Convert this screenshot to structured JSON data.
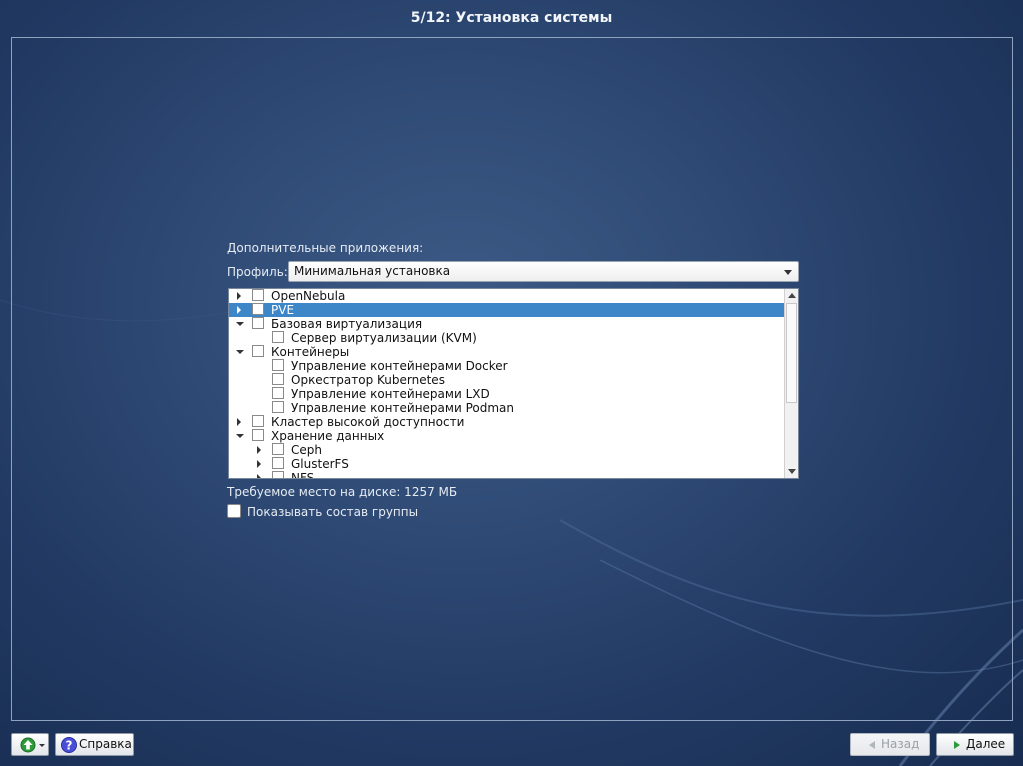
{
  "header": {
    "title": "5/12: Установка системы"
  },
  "apps": {
    "section_label": "Дополнительные приложения:",
    "profile_label": "Профиль:",
    "profile_value": "Минимальная установка",
    "tree": [
      {
        "label": "OpenNebula",
        "level": 0,
        "expander": "collapsed",
        "checked": false,
        "selected": false
      },
      {
        "label": "PVE",
        "level": 0,
        "expander": "collapsed",
        "checked": false,
        "selected": true
      },
      {
        "label": "Базовая виртуализация",
        "level": 0,
        "expander": "expanded",
        "checked": false,
        "selected": false
      },
      {
        "label": "Сервер виртуализации (KVM)",
        "level": 1,
        "expander": "none",
        "checked": false,
        "selected": false
      },
      {
        "label": "Контейнеры",
        "level": 0,
        "expander": "expanded",
        "checked": false,
        "selected": false
      },
      {
        "label": "Управление контейнерами Docker",
        "level": 1,
        "expander": "none",
        "checked": false,
        "selected": false
      },
      {
        "label": "Оркестратор Kubernetes",
        "level": 1,
        "expander": "none",
        "checked": false,
        "selected": false
      },
      {
        "label": "Управление контейнерами LXD",
        "level": 1,
        "expander": "none",
        "checked": false,
        "selected": false
      },
      {
        "label": "Управление контейнерами Podman",
        "level": 1,
        "expander": "none",
        "checked": false,
        "selected": false
      },
      {
        "label": "Кластер высокой доступности",
        "level": 0,
        "expander": "collapsed",
        "checked": false,
        "selected": false
      },
      {
        "label": "Хранение данных",
        "level": 0,
        "expander": "expanded",
        "checked": false,
        "selected": false
      },
      {
        "label": "Ceph",
        "level": 1,
        "expander": "collapsed",
        "checked": false,
        "selected": false
      },
      {
        "label": "GlusterFS",
        "level": 1,
        "expander": "collapsed",
        "checked": false,
        "selected": false
      },
      {
        "label": "NFS",
        "level": 1,
        "expander": "collapsed",
        "checked": false,
        "selected": false
      }
    ],
    "disk_space": "Требуемое место на диске: 1257 МБ",
    "show_group_label": "Показывать состав группы",
    "show_group_checked": false
  },
  "footer": {
    "help_label": "Справка",
    "back_label": "Назад",
    "next_label": "Далее"
  },
  "colors": {
    "selection": "#3d86c8",
    "background": "#2e4a75"
  }
}
